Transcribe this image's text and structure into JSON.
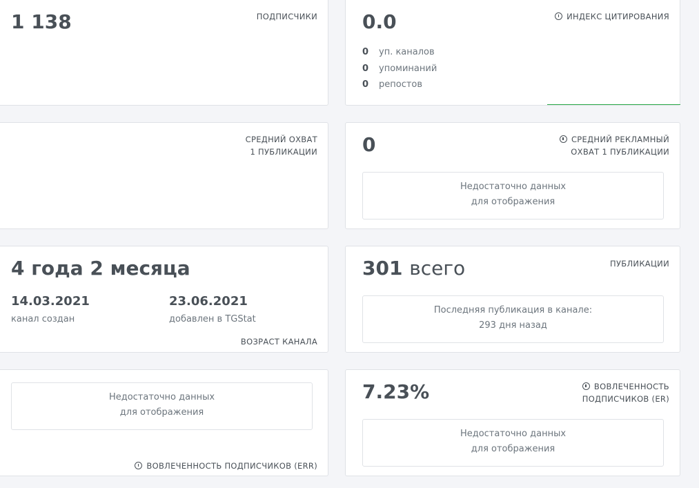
{
  "subscribers": {
    "value": "1 138",
    "label": "ПОДПИСЧИКИ"
  },
  "citation": {
    "value": "0.0",
    "label": "ИНДЕКС ЦИТИРОВАНИЯ",
    "stats": [
      {
        "num": "0",
        "label": "уп. каналов"
      },
      {
        "num": "0",
        "label": "упоминаний"
      },
      {
        "num": "0",
        "label": "репостов"
      }
    ],
    "accent_color": "#28a745"
  },
  "avg_reach": {
    "label_line1": "СРЕДНИЙ ОХВАТ",
    "label_line2": "1 ПУБЛИКАЦИИ"
  },
  "avg_ad_reach": {
    "value": "0",
    "label_line1": "СРЕДНИЙ РЕКЛАМНЫЙ",
    "label_line2": "ОХВАТ 1 ПУБЛИКАЦИИ",
    "nodata_line1": "Недостаточно данных",
    "nodata_line2": "для отображения"
  },
  "channel_age": {
    "value": "4 года 2 месяца",
    "created_date": "14.03.2021",
    "created_label": "канал создан",
    "added_date": "23.06.2021",
    "added_label": "добавлен в TGStat",
    "label": "ВОЗРАСТ КАНАЛА"
  },
  "publications": {
    "value": "301",
    "unit": "всего",
    "label": "ПУБЛИКАЦИИ",
    "last_line1": "Последняя публикация в канале:",
    "last_line2": "293 дня назад"
  },
  "err": {
    "nodata_line1": "Недостаточно данных",
    "nodata_line2": "для отображения",
    "label": "ВОВЛЕЧЕННОСТЬ ПОДПИСЧИКОВ (ERR)"
  },
  "er": {
    "value": "7.23%",
    "label_line1": "ВОВЛЕЧЕННОСТЬ",
    "label_line2": "ПОДПИСЧИКОВ (ER)",
    "nodata_line1": "Недостаточно данных",
    "nodata_line2": "для отображения"
  }
}
